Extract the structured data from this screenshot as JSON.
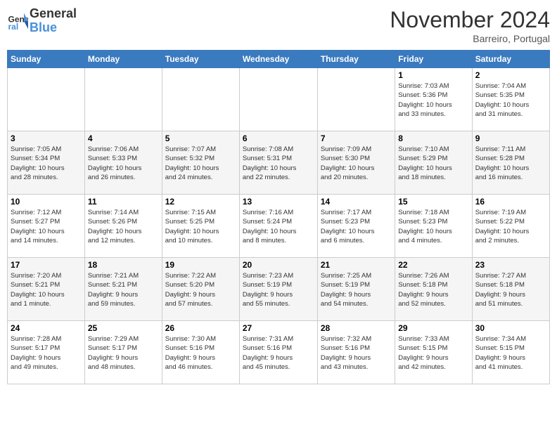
{
  "header": {
    "logo_line1": "General",
    "logo_line2": "Blue",
    "month": "November 2024",
    "location": "Barreiro, Portugal"
  },
  "days_of_week": [
    "Sunday",
    "Monday",
    "Tuesday",
    "Wednesday",
    "Thursday",
    "Friday",
    "Saturday"
  ],
  "weeks": [
    [
      {
        "day": "",
        "info": ""
      },
      {
        "day": "",
        "info": ""
      },
      {
        "day": "",
        "info": ""
      },
      {
        "day": "",
        "info": ""
      },
      {
        "day": "",
        "info": ""
      },
      {
        "day": "1",
        "info": "Sunrise: 7:03 AM\nSunset: 5:36 PM\nDaylight: 10 hours\nand 33 minutes."
      },
      {
        "day": "2",
        "info": "Sunrise: 7:04 AM\nSunset: 5:35 PM\nDaylight: 10 hours\nand 31 minutes."
      }
    ],
    [
      {
        "day": "3",
        "info": "Sunrise: 7:05 AM\nSunset: 5:34 PM\nDaylight: 10 hours\nand 28 minutes."
      },
      {
        "day": "4",
        "info": "Sunrise: 7:06 AM\nSunset: 5:33 PM\nDaylight: 10 hours\nand 26 minutes."
      },
      {
        "day": "5",
        "info": "Sunrise: 7:07 AM\nSunset: 5:32 PM\nDaylight: 10 hours\nand 24 minutes."
      },
      {
        "day": "6",
        "info": "Sunrise: 7:08 AM\nSunset: 5:31 PM\nDaylight: 10 hours\nand 22 minutes."
      },
      {
        "day": "7",
        "info": "Sunrise: 7:09 AM\nSunset: 5:30 PM\nDaylight: 10 hours\nand 20 minutes."
      },
      {
        "day": "8",
        "info": "Sunrise: 7:10 AM\nSunset: 5:29 PM\nDaylight: 10 hours\nand 18 minutes."
      },
      {
        "day": "9",
        "info": "Sunrise: 7:11 AM\nSunset: 5:28 PM\nDaylight: 10 hours\nand 16 minutes."
      }
    ],
    [
      {
        "day": "10",
        "info": "Sunrise: 7:12 AM\nSunset: 5:27 PM\nDaylight: 10 hours\nand 14 minutes."
      },
      {
        "day": "11",
        "info": "Sunrise: 7:14 AM\nSunset: 5:26 PM\nDaylight: 10 hours\nand 12 minutes."
      },
      {
        "day": "12",
        "info": "Sunrise: 7:15 AM\nSunset: 5:25 PM\nDaylight: 10 hours\nand 10 minutes."
      },
      {
        "day": "13",
        "info": "Sunrise: 7:16 AM\nSunset: 5:24 PM\nDaylight: 10 hours\nand 8 minutes."
      },
      {
        "day": "14",
        "info": "Sunrise: 7:17 AM\nSunset: 5:23 PM\nDaylight: 10 hours\nand 6 minutes."
      },
      {
        "day": "15",
        "info": "Sunrise: 7:18 AM\nSunset: 5:23 PM\nDaylight: 10 hours\nand 4 minutes."
      },
      {
        "day": "16",
        "info": "Sunrise: 7:19 AM\nSunset: 5:22 PM\nDaylight: 10 hours\nand 2 minutes."
      }
    ],
    [
      {
        "day": "17",
        "info": "Sunrise: 7:20 AM\nSunset: 5:21 PM\nDaylight: 10 hours\nand 1 minute."
      },
      {
        "day": "18",
        "info": "Sunrise: 7:21 AM\nSunset: 5:21 PM\nDaylight: 9 hours\nand 59 minutes."
      },
      {
        "day": "19",
        "info": "Sunrise: 7:22 AM\nSunset: 5:20 PM\nDaylight: 9 hours\nand 57 minutes."
      },
      {
        "day": "20",
        "info": "Sunrise: 7:23 AM\nSunset: 5:19 PM\nDaylight: 9 hours\nand 55 minutes."
      },
      {
        "day": "21",
        "info": "Sunrise: 7:25 AM\nSunset: 5:19 PM\nDaylight: 9 hours\nand 54 minutes."
      },
      {
        "day": "22",
        "info": "Sunrise: 7:26 AM\nSunset: 5:18 PM\nDaylight: 9 hours\nand 52 minutes."
      },
      {
        "day": "23",
        "info": "Sunrise: 7:27 AM\nSunset: 5:18 PM\nDaylight: 9 hours\nand 51 minutes."
      }
    ],
    [
      {
        "day": "24",
        "info": "Sunrise: 7:28 AM\nSunset: 5:17 PM\nDaylight: 9 hours\nand 49 minutes."
      },
      {
        "day": "25",
        "info": "Sunrise: 7:29 AM\nSunset: 5:17 PM\nDaylight: 9 hours\nand 48 minutes."
      },
      {
        "day": "26",
        "info": "Sunrise: 7:30 AM\nSunset: 5:16 PM\nDaylight: 9 hours\nand 46 minutes."
      },
      {
        "day": "27",
        "info": "Sunrise: 7:31 AM\nSunset: 5:16 PM\nDaylight: 9 hours\nand 45 minutes."
      },
      {
        "day": "28",
        "info": "Sunrise: 7:32 AM\nSunset: 5:16 PM\nDaylight: 9 hours\nand 43 minutes."
      },
      {
        "day": "29",
        "info": "Sunrise: 7:33 AM\nSunset: 5:15 PM\nDaylight: 9 hours\nand 42 minutes."
      },
      {
        "day": "30",
        "info": "Sunrise: 7:34 AM\nSunset: 5:15 PM\nDaylight: 9 hours\nand 41 minutes."
      }
    ]
  ]
}
